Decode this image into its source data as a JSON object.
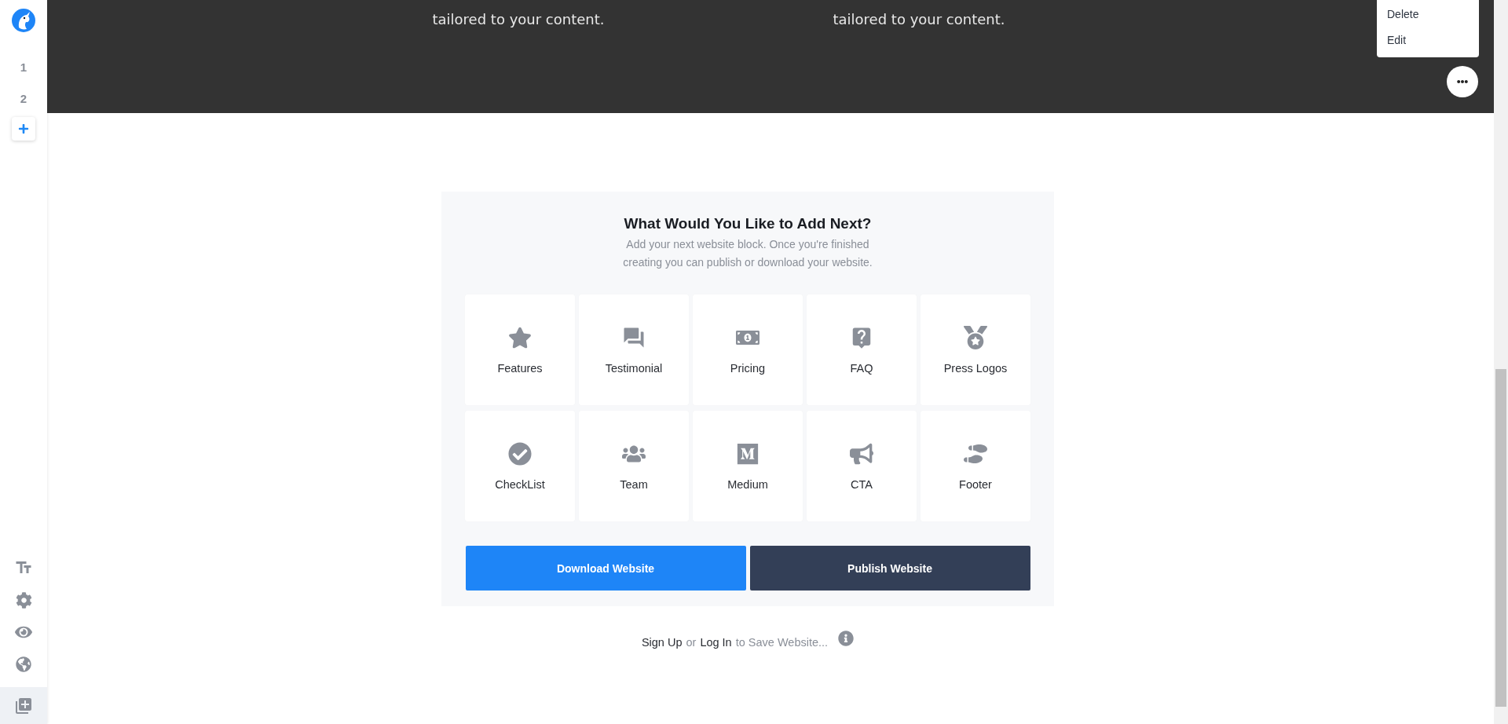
{
  "sidebar": {
    "pages": [
      {
        "label": "1"
      },
      {
        "label": "2"
      }
    ]
  },
  "hero": {
    "columns": [
      {
        "text": "tailored to your content."
      },
      {
        "text": "tailored to your content."
      }
    ]
  },
  "context_menu": {
    "items": [
      "Delete",
      "Edit"
    ]
  },
  "add_block": {
    "title": "What Would You Like to Add Next?",
    "subtitle_lines": [
      "Add your next website block. Once you're finished",
      "creating you can publish or download your website."
    ],
    "blocks": [
      {
        "label": "Features"
      },
      {
        "label": "Testimonial"
      },
      {
        "label": "Pricing"
      },
      {
        "label": "FAQ"
      },
      {
        "label": "Press Logos"
      },
      {
        "label": "CheckList"
      },
      {
        "label": "Team"
      },
      {
        "label": "Medium"
      },
      {
        "label": "CTA"
      },
      {
        "label": "Footer"
      }
    ],
    "buttons": [
      {
        "label": "Download Website",
        "kind": "primary"
      },
      {
        "label": "Publish Website",
        "kind": "dark"
      }
    ]
  },
  "save_prompt": {
    "sign_up": "Sign Up",
    "or": "or",
    "log_in": "Log In",
    "rest": "to Save Website..."
  }
}
